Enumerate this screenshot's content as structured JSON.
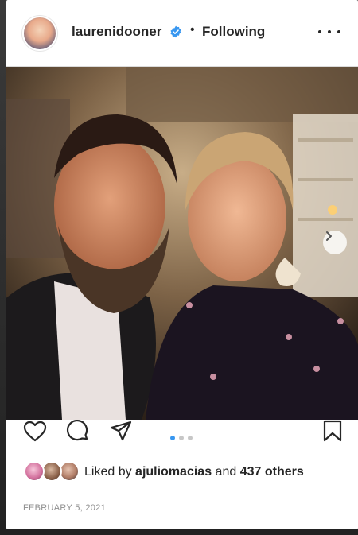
{
  "post": {
    "username": "laurenidooner",
    "separator": "•",
    "follow_status": "Following",
    "verified": true,
    "more_icon": "more-horizontal-icon",
    "photo_alt": "",
    "carousel": {
      "count": 3,
      "active_index": 0
    },
    "actions": {
      "like_icon": "heart-icon",
      "comment_icon": "comment-icon",
      "share_icon": "share-icon",
      "save_icon": "bookmark-icon"
    },
    "likes": {
      "prefix": "Liked by",
      "user": "ajuliomacias",
      "conjunction": "and",
      "others": "437 others"
    },
    "date": "FEBRUARY 5, 2021"
  },
  "colors": {
    "text": "#262626",
    "verified": "#3897f0",
    "muted": "#8e8e8e",
    "carousel_active": "#3897f0",
    "carousel_inactive": "#c7c7c7"
  }
}
